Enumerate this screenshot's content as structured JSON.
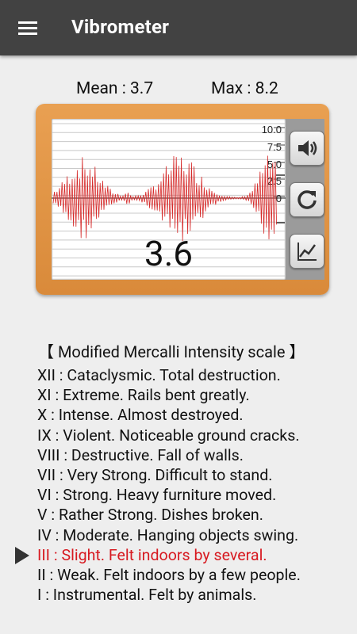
{
  "app": {
    "title": "Vibrometer",
    "menu_icon": "hamburger-menu-icon"
  },
  "stats": {
    "mean": "Mean : 3.7",
    "max": "Max : 8.2"
  },
  "meter": {
    "reading": "3.6",
    "axis_labels": [
      "10.0",
      "7.5",
      "5.0",
      "2.5",
      "0"
    ],
    "colors": {
      "wave": "#d62a2a",
      "frame": "#e39546",
      "gridline": "#999999"
    }
  },
  "side_buttons": {
    "sound": "speaker-volume-icon",
    "reset": "refresh-icon",
    "graph": "line-chart-icon"
  },
  "scale": {
    "title": "【 Modified Mercalli Intensity scale 】",
    "active_level": "III",
    "items": [
      "XII : Cataclysmic. Total destruction.",
      "XI : Extreme. Rails bent greatly.",
      "X  : Intense. Almost destroyed.",
      "IX : Violent. Noticeable ground cracks.",
      "VIII : Destructive. Fall of walls.",
      "VII : Very Strong. Difficult to stand.",
      "VI : Strong. Heavy furniture moved.",
      "V  : Rather Strong. Dishes broken.",
      "IV : Moderate. Hanging objects swing.",
      "III : Slight. Felt indoors by several.",
      "II : Weak. Felt indoors by a few people.",
      "I  : Instrumental. Felt by animals."
    ]
  }
}
